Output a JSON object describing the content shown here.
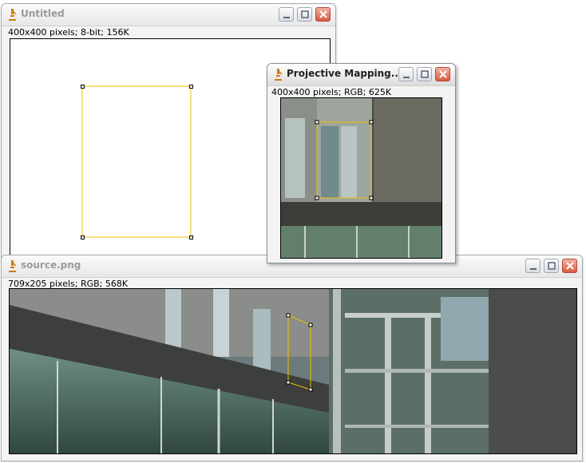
{
  "windows": {
    "untitled": {
      "title": "Untitled",
      "info": "400x400 pixels; 8-bit; 156K"
    },
    "projective": {
      "title": "Projective Mapping...",
      "info": "400x400 pixels; RGB; 625K"
    },
    "source": {
      "title": "source.png",
      "info": "709x205 pixels; RGB; 568K"
    }
  },
  "icons": {
    "app": "microscope-icon",
    "minimize": "minimize-icon",
    "maximize": "maximize-icon",
    "close": "close-icon"
  },
  "colors": {
    "selection": "#f0c000",
    "close_button": "#d95a3f",
    "titlebar_inactive_text": "#9a9a9a",
    "titlebar_active_text": "#1f1f1f"
  }
}
